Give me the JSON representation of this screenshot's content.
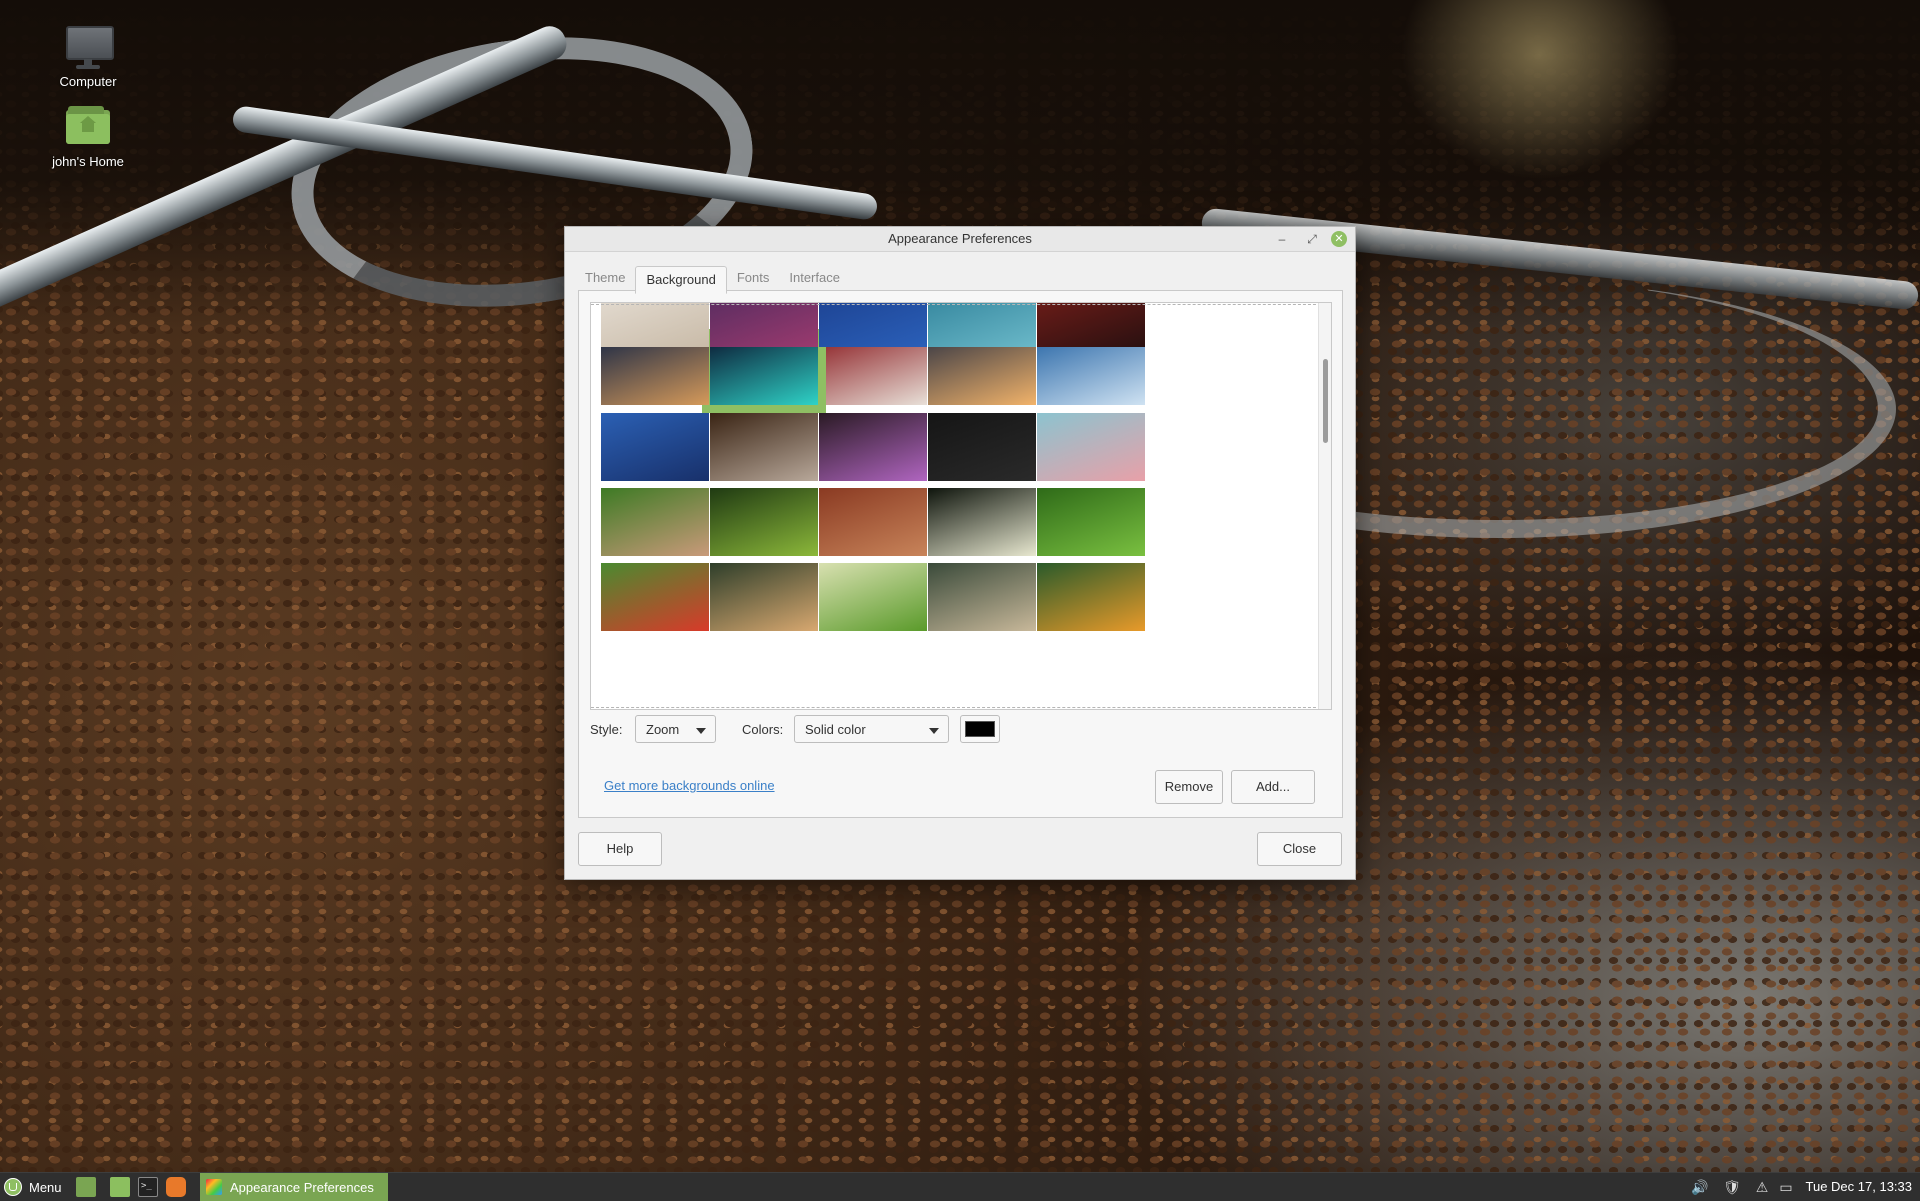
{
  "desktop": {
    "icons": [
      {
        "label": "Computer",
        "icon": "monitor-icon"
      },
      {
        "label": "john's Home",
        "icon": "home-folder-icon"
      }
    ]
  },
  "window": {
    "title": "Appearance Preferences",
    "controls": {
      "minimize": "–",
      "maximize": "⤢",
      "close": "✕"
    },
    "tabs": [
      {
        "label": "Theme",
        "active": false
      },
      {
        "label": "Background",
        "active": true
      },
      {
        "label": "Fonts",
        "active": false
      },
      {
        "label": "Interface",
        "active": false
      }
    ],
    "gallery": {
      "selected_index": 6,
      "thumbnails": [
        {
          "desc": "partial-sand",
          "colors": [
            "#e8e1d8",
            "#c9bba8"
          ]
        },
        {
          "desc": "partial-purple",
          "colors": [
            "#4d2a5e",
            "#9a3a6e"
          ]
        },
        {
          "desc": "partial-blue",
          "colors": [
            "#1b3e8c",
            "#2a5fb8"
          ]
        },
        {
          "desc": "partial-teal",
          "colors": [
            "#2b7d96",
            "#6ab8c8"
          ]
        },
        {
          "desc": "partial-red",
          "colors": [
            "#7a1f1a",
            "#2a1010"
          ]
        },
        {
          "desc": "dusk-city",
          "colors": [
            "#1d2a45",
            "#d69a5a"
          ]
        },
        {
          "desc": "teal-bridge",
          "colors": [
            "#0b1a33",
            "#2fd3c7"
          ]
        },
        {
          "desc": "white-blossoms-red",
          "colors": [
            "#8c1f24",
            "#e8e0d8"
          ]
        },
        {
          "desc": "city-sunset",
          "colors": [
            "#3a3a44",
            "#f2b36a"
          ]
        },
        {
          "desc": "blue-mountains",
          "colors": [
            "#2d6aa8",
            "#cfe2f2"
          ]
        },
        {
          "desc": "coast-blue",
          "colors": [
            "#2b60b4",
            "#18306a"
          ]
        },
        {
          "desc": "coffee-roaster",
          "colors": [
            "#3a2414",
            "#b8a89a"
          ]
        },
        {
          "desc": "purple-flower",
          "colors": [
            "#2a1a24",
            "#b065c0"
          ]
        },
        {
          "desc": "dark-logo",
          "colors": [
            "#151515",
            "#2a2a2a"
          ]
        },
        {
          "desc": "pink-blossoms",
          "colors": [
            "#8cc3cf",
            "#e8a0a8"
          ]
        },
        {
          "desc": "field-road",
          "colors": [
            "#3d7a24",
            "#c99a7a"
          ]
        },
        {
          "desc": "green-hills",
          "colors": [
            "#1f3a12",
            "#8cb83a"
          ]
        },
        {
          "desc": "rooftops",
          "colors": [
            "#8a3a22",
            "#c8845a"
          ]
        },
        {
          "desc": "white-flowers-dark",
          "colors": [
            "#0e140c",
            "#e8e8d0"
          ]
        },
        {
          "desc": "yellow-flower-grass",
          "colors": [
            "#2e6a18",
            "#7ac040"
          ]
        },
        {
          "desc": "green-bud",
          "colors": [
            "#4a8a30",
            "#d83a2a"
          ]
        },
        {
          "desc": "valley-sunset",
          "colors": [
            "#2e3e2a",
            "#d8a870"
          ]
        },
        {
          "desc": "grass-light",
          "colors": [
            "#d8e0b0",
            "#5a9a2a"
          ]
        },
        {
          "desc": "fountain",
          "colors": [
            "#3a4a3a",
            "#c8b89a"
          ]
        },
        {
          "desc": "oranges-villa",
          "colors": [
            "#2a5a2a",
            "#e89a2a"
          ]
        }
      ]
    },
    "style": {
      "label": "Style:",
      "value": "Zoom"
    },
    "colors": {
      "label": "Colors:",
      "value": "Solid color",
      "swatch": "#000000"
    },
    "link_text": "Get more backgrounds online",
    "buttons": {
      "remove": "Remove",
      "add": "Add...",
      "help": "Help",
      "close": "Close"
    }
  },
  "taskbar": {
    "menu_label": "Menu",
    "task_label": "Appearance Preferences",
    "terminal_glyph": ">_",
    "tray_icons": [
      "volume-icon",
      "shield-icon",
      "warning-icon",
      "window-list-icon"
    ],
    "tray_glyphs": [
      "🔊",
      "🛡",
      "⚠",
      "▭"
    ],
    "clock": "Tue Dec 17, 13:33"
  },
  "colors": {
    "accent": "#8fbf63",
    "taskbar": "#2f2f2f",
    "link": "#3b80c8"
  }
}
